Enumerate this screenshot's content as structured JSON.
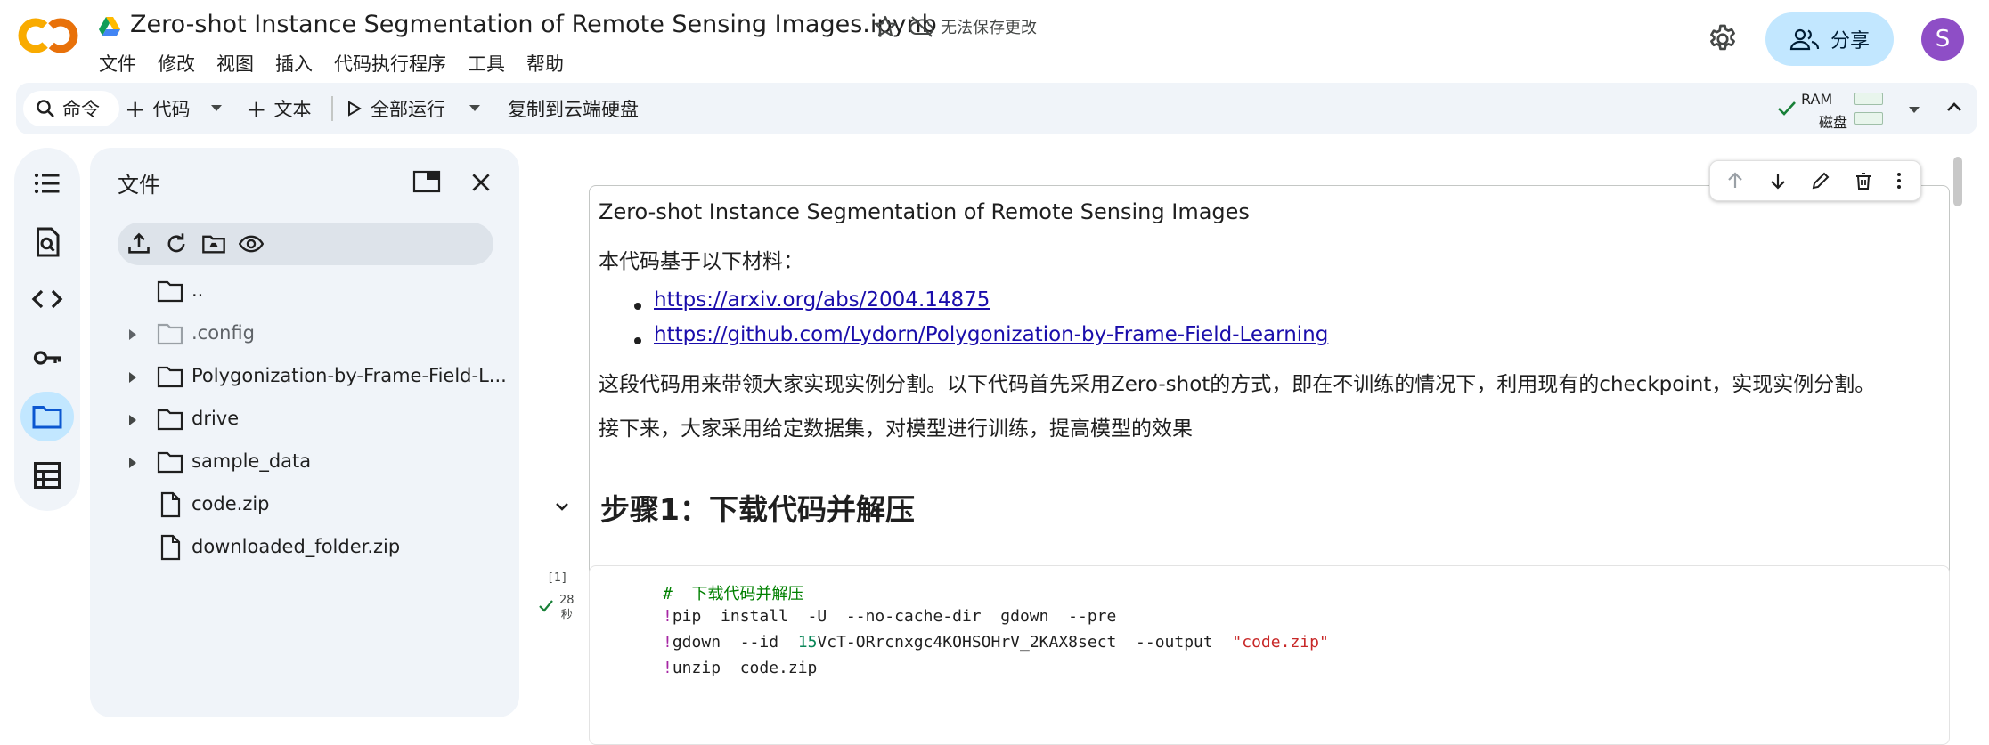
{
  "header": {
    "title": "Zero-shot Instance Segmentation of Remote Sensing Images.ipynb",
    "unsaved_status": "无法保存更改",
    "menu": [
      "文件",
      "修改",
      "视图",
      "插入",
      "代码执行程序",
      "工具",
      "帮助"
    ],
    "share_label": "分享",
    "avatar_letter": "S"
  },
  "toolbar": {
    "command_label": "命令",
    "code_label": "代码",
    "text_label": "文本",
    "run_all_label": "全部运行",
    "copy_to_drive_label": "复制到云端硬盘",
    "ram_label": "RAM",
    "disk_label": "磁盘"
  },
  "file_panel": {
    "title": "文件",
    "items": [
      {
        "name": "..",
        "type": "folder",
        "expandable": false
      },
      {
        "name": ".config",
        "type": "folder",
        "expandable": true
      },
      {
        "name": "Polygonization-by-Frame-Field-L...",
        "type": "folder",
        "expandable": true
      },
      {
        "name": "drive",
        "type": "folder",
        "expandable": true
      },
      {
        "name": "sample_data",
        "type": "folder",
        "expandable": true
      },
      {
        "name": "code.zip",
        "type": "file",
        "expandable": false
      },
      {
        "name": "downloaded_folder.zip",
        "type": "file",
        "expandable": false
      }
    ]
  },
  "text_cell": {
    "heading": "Zero-shot Instance Segmentation of Remote Sensing Images",
    "intro": "本代码基于以下材料：",
    "links": [
      "https://arxiv.org/abs/2004.14875",
      "https://github.com/Lydorn/Polygonization-by-Frame-Field-Learning"
    ],
    "para1": "这段代码用来带领大家实现实例分割。以下代码首先采用Zero-shot的方式，即在不训练的情况下，利用现有的checkpoint，实现实例分割。",
    "para2": "接下来，大家采用给定数据集，对模型进行训练，提高模型的效果"
  },
  "section": {
    "title": "步骤1：下载代码并解压"
  },
  "code_cell": {
    "exec_count": "[1]",
    "exec_time_value": "28",
    "exec_time_unit": "秒",
    "comment": "#  下载代码并解压",
    "line1_bang": "!",
    "line1": "pip  install  -U  --no-cache-dir  gdown  --pre",
    "line2_bang": "!",
    "line2_a": "gdown  --id  ",
    "line2_num": "15",
    "line2_b": "VcT-ORrcnxgc4KOHSOHrV_2KAX8sect  --output  ",
    "line2_str": "\"code.zip\"",
    "line3_bang": "!",
    "line3": "unzip  code.zip"
  },
  "colors": {
    "accent_blue": "#c2e7ff",
    "panel_bg": "#f0f4f9",
    "link": "#1a0dab",
    "avatar": "#8e4ec6",
    "logo_orange": "#f9ab00",
    "logo_dark_orange": "#e8710a"
  }
}
